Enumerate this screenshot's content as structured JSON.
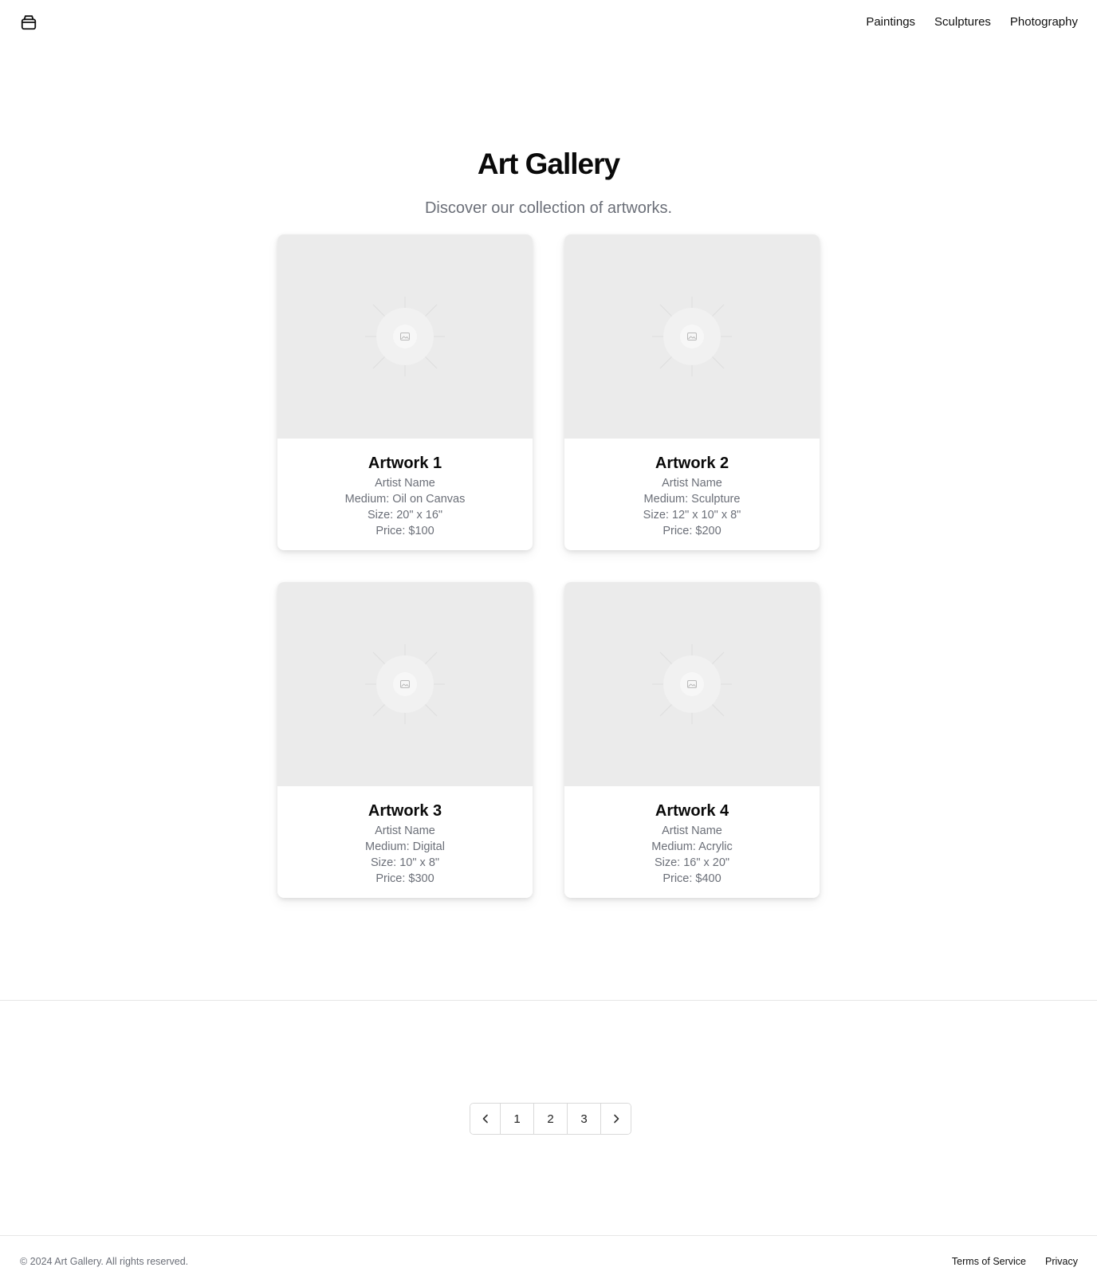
{
  "header": {
    "logo_icon": "package-icon",
    "nav": [
      {
        "label": "Paintings"
      },
      {
        "label": "Sculptures"
      },
      {
        "label": "Photography"
      }
    ]
  },
  "hero": {
    "title": "Art Gallery",
    "subtitle": "Discover our collection of artworks."
  },
  "artworks": [
    {
      "title": "Artwork 1",
      "artist": "Artist Name",
      "medium": "Medium: Oil on Canvas",
      "size": "Size: 20\" x 16\"",
      "price": "Price: $100",
      "image_icon": "image-placeholder-icon"
    },
    {
      "title": "Artwork 2",
      "artist": "Artist Name",
      "medium": "Medium: Sculpture",
      "size": "Size: 12\" x 10\" x 8\"",
      "price": "Price: $200",
      "image_icon": "image-placeholder-icon"
    },
    {
      "title": "Artwork 3",
      "artist": "Artist Name",
      "medium": "Medium: Digital",
      "size": "Size: 10\" x 8\"",
      "price": "Price: $300",
      "image_icon": "image-placeholder-icon"
    },
    {
      "title": "Artwork 4",
      "artist": "Artist Name",
      "medium": "Medium: Acrylic",
      "size": "Size: 16\" x 20\"",
      "price": "Price: $400",
      "image_icon": "image-placeholder-icon"
    }
  ],
  "pagination": {
    "prev_icon": "chevron-left-icon",
    "pages": [
      "1",
      "2",
      "3"
    ],
    "next_icon": "chevron-right-icon"
  },
  "footer": {
    "copyright": "© 2024 Art Gallery. All rights reserved.",
    "links": [
      {
        "label": "Terms of Service"
      },
      {
        "label": "Privacy"
      }
    ]
  },
  "colors": {
    "text": "#111111",
    "muted": "#6b6f78",
    "placeholder_bg": "#ebebeb",
    "border": "#d9d9d9"
  }
}
